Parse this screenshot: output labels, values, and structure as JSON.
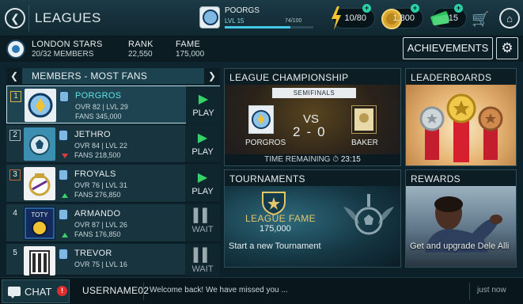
{
  "header": {
    "back_glyph": "❮",
    "title": "LEAGUES",
    "profile": {
      "name": "POORGS",
      "level": "LVL 15",
      "xp": "74/100",
      "xp_fraction": 0.74
    },
    "resources": [
      {
        "icon": "energy-icon",
        "value": "10/80",
        "plus": "+"
      },
      {
        "icon": "coins-icon",
        "value": "1,800",
        "plus": "+"
      },
      {
        "icon": "cash-icon",
        "value": "15",
        "plus": "+"
      }
    ],
    "cart_glyph": "🛒",
    "home_glyph": "⌂"
  },
  "team": {
    "name": "LONDON STARS",
    "members": "20/32 MEMBERS",
    "rank_label": "RANK",
    "rank_value": "22,550",
    "fame_label": "FAME",
    "fame_value": "175,000",
    "achievements_label": "ACHIEVEMENTS",
    "gear_glyph": "⚙"
  },
  "members": {
    "title": "MEMBERS - MOST FANS",
    "prev_glyph": "❮",
    "next_glyph": "❯",
    "rows": [
      {
        "rank": "1",
        "name": "PORGROS",
        "ovr_lvl": "OVR 82 | LVL 29",
        "fans": "FANS 345,000",
        "action": "PLAY",
        "glyph": "▶",
        "trend": "none"
      },
      {
        "rank": "2",
        "name": "JETHRO",
        "ovr_lvl": "OVR 84 | LVL 22",
        "fans": "FANS 218,500",
        "action": "PLAY",
        "glyph": "▶",
        "trend": "down"
      },
      {
        "rank": "3",
        "name": "FROYALS",
        "ovr_lvl": "OVR 76 | LVL 31",
        "fans": "FANS 276,850",
        "action": "PLAY",
        "glyph": "▶",
        "trend": "up"
      },
      {
        "rank": "4",
        "name": "ARMANDO",
        "ovr_lvl": "OVR 87 | LVL 26",
        "fans": "FANS 176,850",
        "action": "WAIT",
        "glyph": "▌▌",
        "trend": "up"
      },
      {
        "rank": "5",
        "name": "TREVOR",
        "ovr_lvl": "OVR 75 | LVL 16",
        "fans": "",
        "action": "WAIT",
        "glyph": "▌▌",
        "trend": "none"
      }
    ]
  },
  "league_championship": {
    "title": "LEAGUE CHAMPIONSHIP",
    "stage": "SEMIFINALS",
    "vs": "VS",
    "score_home": "2",
    "score_sep": "-",
    "score_away": "0",
    "home": "PORGROS",
    "away": "BAKER",
    "time_label": "TIME REMAINING",
    "time_value": "23:15"
  },
  "leaderboards": {
    "title": "LEADERBOARDS"
  },
  "tournaments": {
    "title": "TOURNAMENTS",
    "fame_label": "LEAGUE FAME",
    "fame_value": "175,000",
    "description": "Start a new Tournament"
  },
  "rewards": {
    "title": "REWARDS",
    "description": "Get and upgrade Dele Alli"
  },
  "chat": {
    "label": "CHAT",
    "alert": "!",
    "username": "USERNAME02",
    "message": "Welcome back! We have missed you ...",
    "time": "just now"
  },
  "colors": {
    "accent": "#5fe3e6",
    "play": "#34d36a",
    "gold": "#e3c66a",
    "alert": "#e02c2c"
  }
}
